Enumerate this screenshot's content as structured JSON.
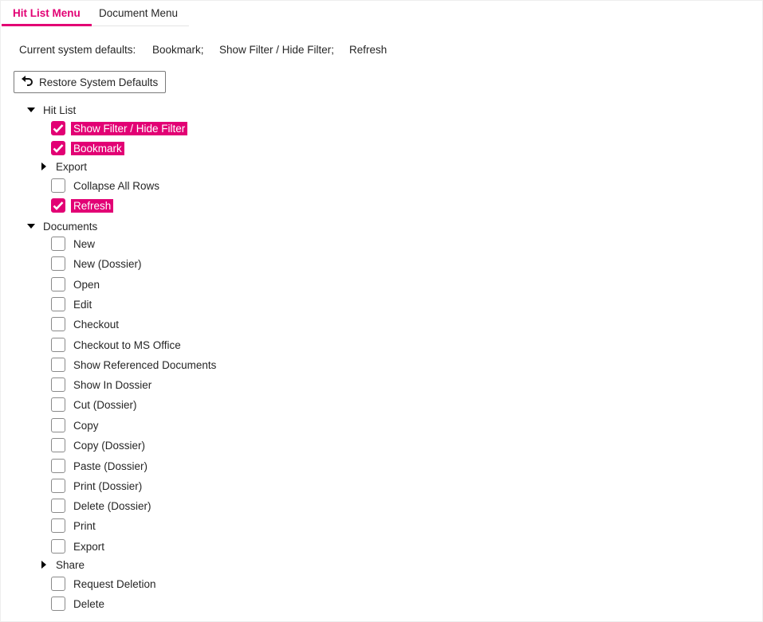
{
  "tabs": [
    {
      "label": "Hit List Menu",
      "active": true
    },
    {
      "label": "Document Menu",
      "active": false
    }
  ],
  "defaults": {
    "label": "Current system defaults:",
    "items": [
      "Bookmark;",
      "Show Filter / Hide Filter;",
      "Refresh"
    ]
  },
  "restore_button": {
    "label": "Restore System Defaults",
    "icon": "undo-icon"
  },
  "tree": {
    "hit_list": {
      "label": "Hit List",
      "expanded": true,
      "items": [
        {
          "label": "Show Filter / Hide Filter",
          "checked": true
        },
        {
          "label": "Bookmark",
          "checked": true
        },
        {
          "label": "Export",
          "type": "group",
          "expanded": false
        },
        {
          "label": "Collapse All Rows",
          "checked": false
        },
        {
          "label": "Refresh",
          "checked": true
        }
      ]
    },
    "documents": {
      "label": "Documents",
      "expanded": true,
      "items": [
        {
          "label": "New",
          "checked": false
        },
        {
          "label": "New (Dossier)",
          "checked": false
        },
        {
          "label": "Open",
          "checked": false
        },
        {
          "label": "Edit",
          "checked": false
        },
        {
          "label": "Checkout",
          "checked": false
        },
        {
          "label": "Checkout to MS Office",
          "checked": false
        },
        {
          "label": "Show Referenced Documents",
          "checked": false
        },
        {
          "label": "Show In Dossier",
          "checked": false
        },
        {
          "label": "Cut (Dossier)",
          "checked": false
        },
        {
          "label": "Copy",
          "checked": false
        },
        {
          "label": "Copy (Dossier)",
          "checked": false
        },
        {
          "label": "Paste (Dossier)",
          "checked": false
        },
        {
          "label": "Print (Dossier)",
          "checked": false
        },
        {
          "label": "Delete (Dossier)",
          "checked": false
        },
        {
          "label": "Print",
          "checked": false
        },
        {
          "label": "Export",
          "checked": false
        },
        {
          "label": "Share",
          "type": "group",
          "expanded": false
        },
        {
          "label": "Request Deletion",
          "checked": false
        },
        {
          "label": "Delete",
          "checked": false
        }
      ]
    }
  },
  "colors": {
    "accent": "#e20074",
    "text": "#262626",
    "border": "#8a8a8a"
  }
}
